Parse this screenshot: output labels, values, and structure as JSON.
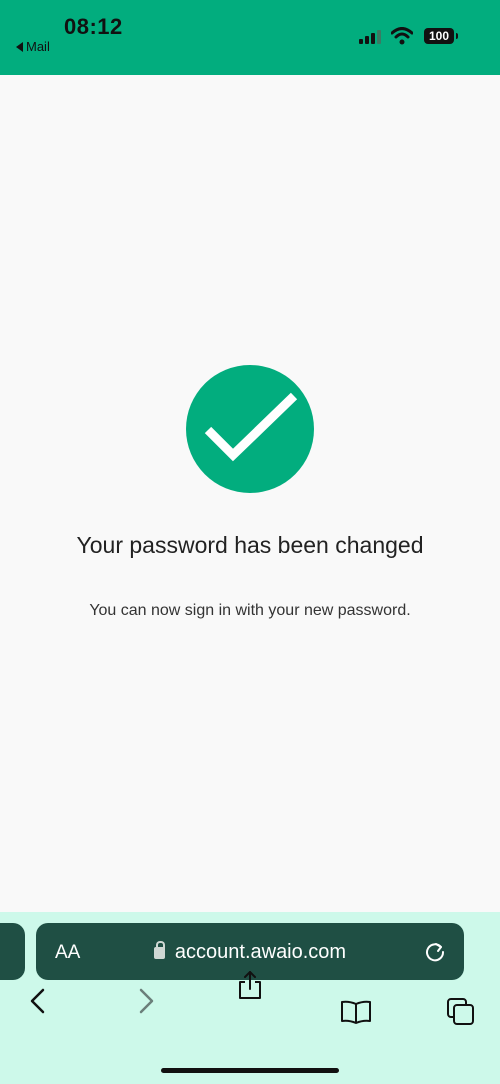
{
  "status_bar": {
    "time": "08:12",
    "back_app_label": "Mail",
    "battery": "100",
    "background_color": "#02ad7e"
  },
  "content": {
    "icon": "checkmark-icon",
    "accent_color": "#02ad7e",
    "title": "Your password has been changed",
    "subtitle": "You can now sign in with your new password."
  },
  "browser": {
    "text_size_label": "AA",
    "url": "account.awaio.com",
    "bar_color": "#1f4f44",
    "toolbar_background": "#cdf9ea",
    "toolbar_icons": [
      "back-icon",
      "forward-icon",
      "share-icon",
      "bookmarks-icon",
      "tabs-icon"
    ]
  }
}
